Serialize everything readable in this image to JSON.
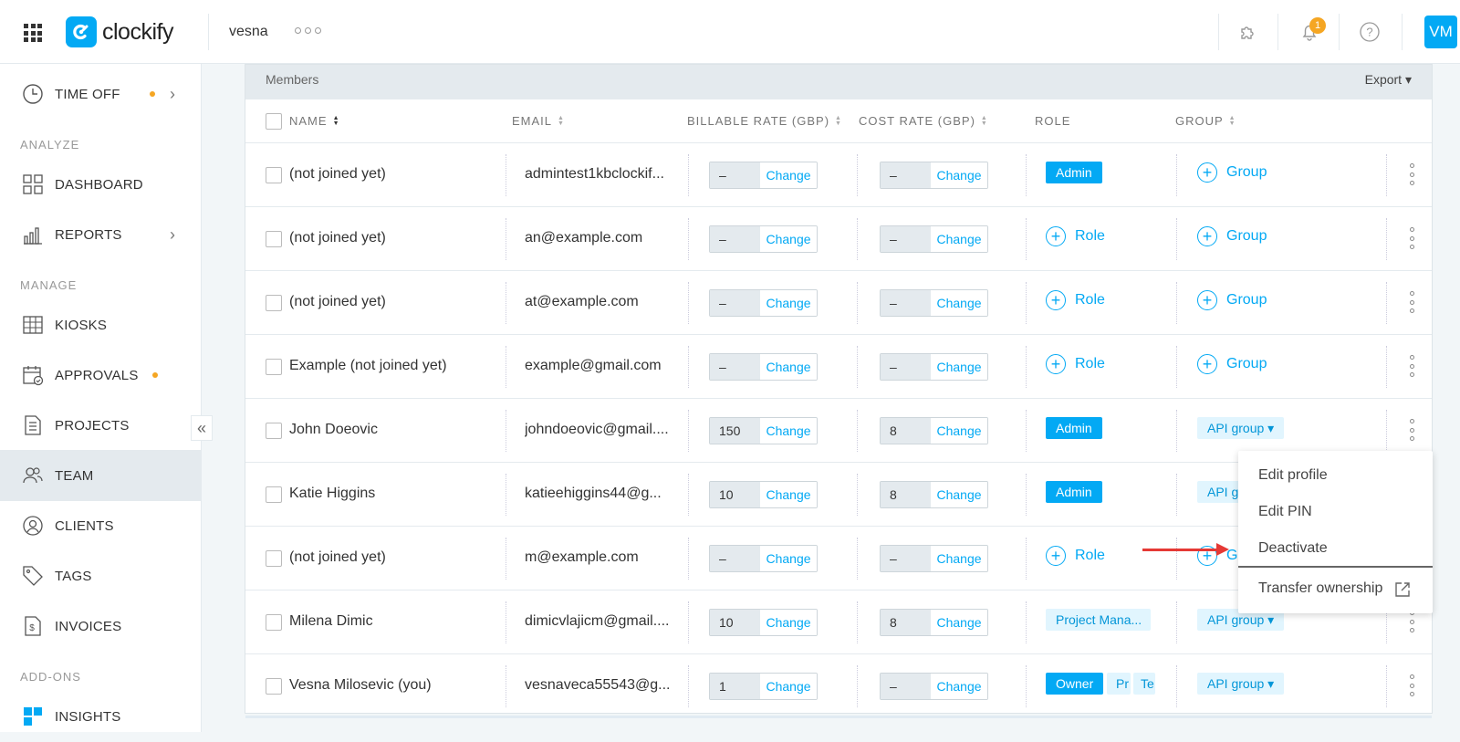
{
  "topbar": {
    "logo_text": "clockify",
    "workspace": "vesna",
    "notifications_count": "1",
    "avatar_initials": "VM"
  },
  "sidebar": {
    "time_off": "TIME OFF",
    "section_analyze": "ANALYZE",
    "dashboard": "DASHBOARD",
    "reports": "REPORTS",
    "section_manage": "MANAGE",
    "kiosks": "KIOSKS",
    "approvals": "APPROVALS",
    "projects": "PROJECTS",
    "team": "TEAM",
    "clients": "CLIENTS",
    "tags": "TAGS",
    "invoices": "INVOICES",
    "section_addons": "ADD-ONS",
    "insights": "INSIGHTS"
  },
  "members": {
    "title": "Members",
    "export_label": "Export",
    "columns": {
      "name": "NAME",
      "email": "EMAIL",
      "billable": "BILLABLE RATE (GBP)",
      "cost": "COST RATE (GBP)",
      "role": "ROLE",
      "group": "GROUP"
    },
    "change_label": "Change",
    "role_add_label": "Role",
    "group_add_label": "Group",
    "rows": [
      {
        "name": "(not joined yet)",
        "email": "admintest1kbclockif...",
        "billable": "–",
        "cost": "–",
        "role": "Admin",
        "group": "Group"
      },
      {
        "name": "(not joined yet)",
        "email": "an@example.com",
        "billable": "–",
        "cost": "–",
        "role": "Role",
        "group": "Group"
      },
      {
        "name": "(not joined yet)",
        "email": "at@example.com",
        "billable": "–",
        "cost": "–",
        "role": "Role",
        "group": "Group"
      },
      {
        "name": "Example (not joined yet)",
        "email": "example@gmail.com",
        "billable": "–",
        "cost": "–",
        "role": "Role",
        "group": "Group"
      },
      {
        "name": "John Doeovic",
        "email": "johndoeovic@gmail....",
        "billable": "150",
        "cost": "8",
        "role": "Admin",
        "group": "API group"
      },
      {
        "name": "Katie Higgins",
        "email": "katieehiggins44@g...",
        "billable": "10",
        "cost": "8",
        "role": "Admin",
        "group": "API gr"
      },
      {
        "name": "(not joined yet)",
        "email": "m@example.com",
        "billable": "–",
        "cost": "–",
        "role": "Role",
        "group": "G"
      },
      {
        "name": "Milena Dimic",
        "email": "dimicvlajicm@gmail....",
        "billable": "10",
        "cost": "8",
        "role": "Project Mana...",
        "group": "API group"
      },
      {
        "name": "Vesna Milosevic (you)",
        "email": "vesnaveca55543@g...",
        "billable": "1",
        "cost": "–",
        "role": "Owner",
        "role_extra1": "Pr",
        "role_extra2": "Te",
        "group": "API group"
      }
    ]
  },
  "context_menu": {
    "edit_profile": "Edit profile",
    "edit_pin": "Edit PIN",
    "deactivate": "Deactivate",
    "transfer_ownership": "Transfer ownership"
  },
  "colors": {
    "accent": "#03a9f4",
    "orange": "#f5a623",
    "arrow": "#e53935"
  }
}
